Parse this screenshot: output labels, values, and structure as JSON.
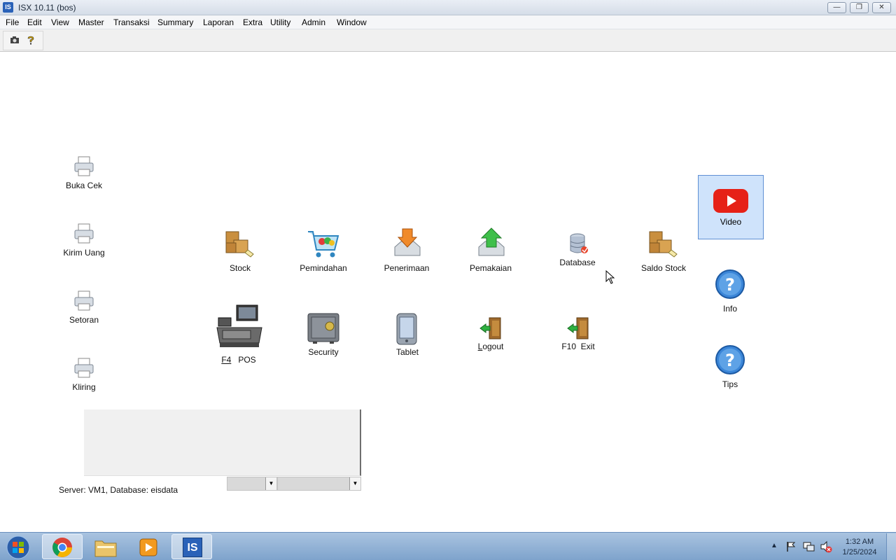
{
  "window": {
    "title": "ISX 10.11 (bos)",
    "app_icon_text": "IS"
  },
  "menu": [
    "File",
    "Edit",
    "View",
    "Master",
    "Transaksi",
    "Summary",
    "Laporan",
    "Extra",
    "Utility",
    "Admin",
    "Window"
  ],
  "left_icons": {
    "buka_cek": "Buka Cek",
    "kirim_uang": "Kirim Uang",
    "setoran": "Setoran",
    "kliring": "Kliring"
  },
  "main_icons": {
    "stock": "Stock",
    "pemindahan": "Pemindahan",
    "penerimaan": "Penerimaan",
    "pemakaian": "Pemakaian",
    "database": "Database",
    "saldo_stock": "Saldo Stock",
    "pos_key": "F4",
    "pos_label": "POS",
    "security": "Security",
    "tablet": "Tablet",
    "logout": "Logout",
    "exit_key": "F10",
    "exit_label": "Exit"
  },
  "right_icons": {
    "video": "Video",
    "info": "Info",
    "tips": "Tips"
  },
  "status": {
    "server_text": "Server: VM1,  Database: eisdata"
  },
  "taskbar": {
    "time": "1:32 AM",
    "date": "1/25/2024"
  },
  "colors": {
    "youtube_red": "#e62117",
    "help_blue": "#3b86d8",
    "taskbar": "#8fb0d6"
  }
}
